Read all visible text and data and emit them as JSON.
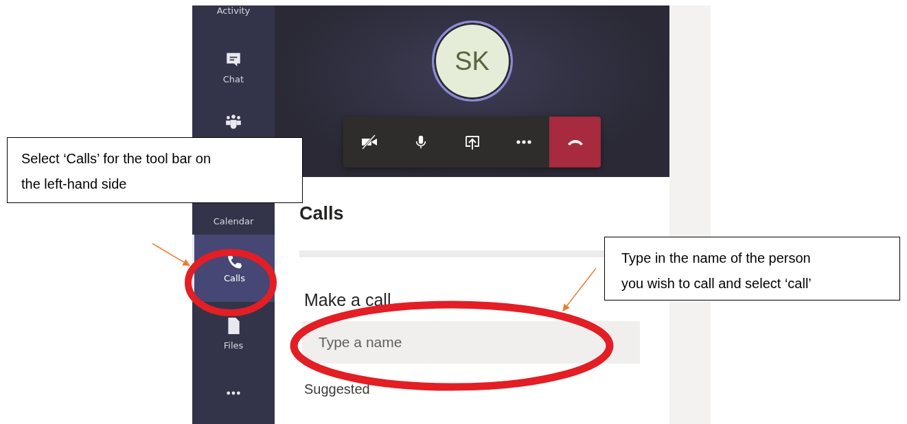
{
  "sidebar": {
    "items": [
      {
        "kind": "none",
        "label": "Activity",
        "selected": false
      },
      {
        "kind": "chat",
        "label": "Chat",
        "selected": false
      },
      {
        "kind": "teams",
        "selected": false
      },
      {
        "kind": "none",
        "label": "Calendar",
        "selected": false
      },
      {
        "kind": "calls",
        "label": "Calls",
        "selected": true
      },
      {
        "kind": "files",
        "label": "Files",
        "selected": false
      },
      {
        "kind": "more",
        "selected": false
      }
    ]
  },
  "call_window": {
    "avatar_initials": "SK",
    "controls": [
      {
        "kind": "camera-off"
      },
      {
        "kind": "mic"
      },
      {
        "kind": "share"
      },
      {
        "kind": "more"
      },
      {
        "kind": "hang-up"
      }
    ]
  },
  "calls_page": {
    "title": "Calls",
    "section_title": "Make a call",
    "search": {
      "placeholder": "Type a name"
    },
    "suggested_label": "Suggested"
  },
  "annotations": [
    {
      "text": "Select ‘Calls’ for the tool bar on the left-hand side"
    },
    {
      "text": "Type in the name of the person you wish to call and select ‘call’"
    }
  ]
}
